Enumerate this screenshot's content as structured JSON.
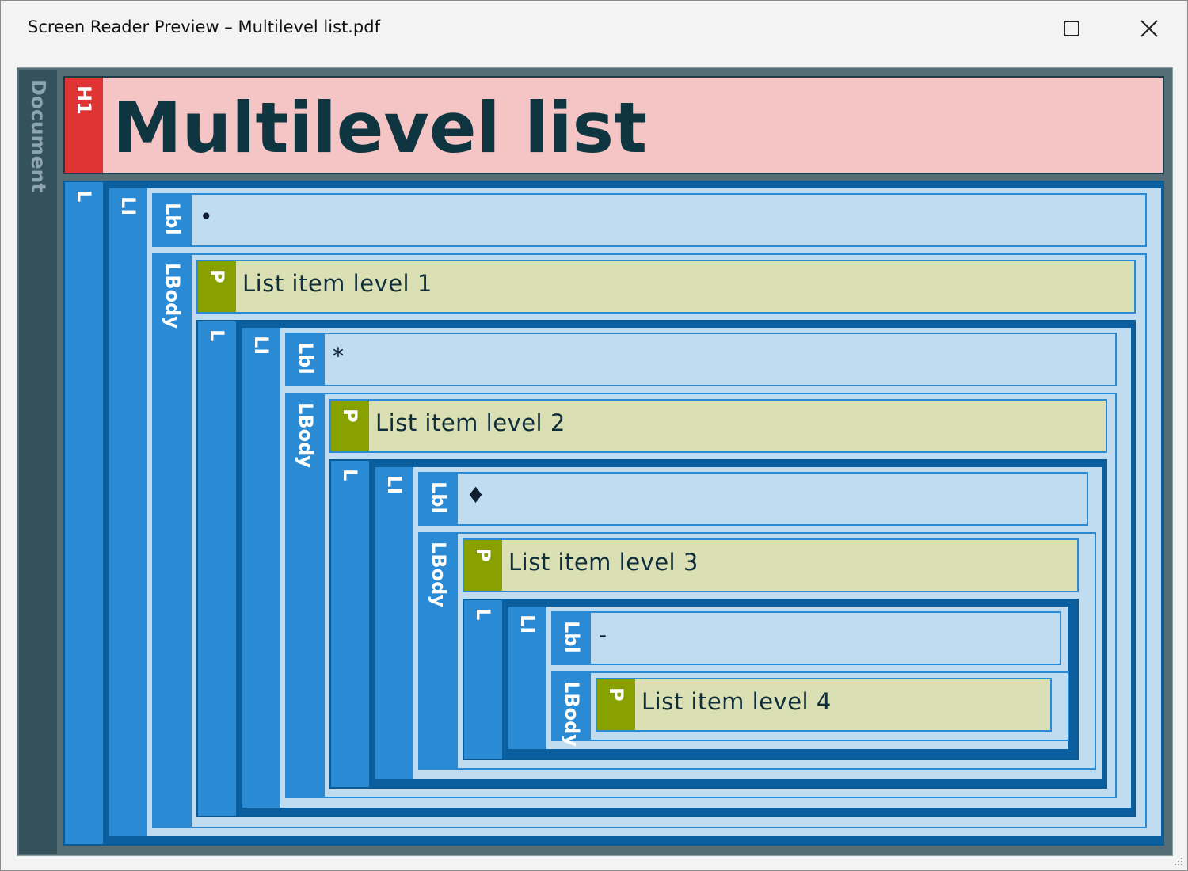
{
  "window": {
    "title": "Screen Reader Preview – Multilevel list.pdf",
    "maximize_icon": "maximize-icon",
    "close_icon": "close-icon"
  },
  "colors": {
    "document": "#35515c",
    "heading_tag": "#e03333",
    "heading_bg": "#f5c4c4",
    "list_dark": "#0b5f9e",
    "list_tag": "#2a8bd4",
    "list_light": "#bfdcf1",
    "para_tag": "#88a000",
    "para_bg": "#dbe0b4"
  },
  "document": {
    "tag": "Document",
    "heading": {
      "tag": "H1",
      "text": "Multilevel list"
    },
    "list": {
      "tags": {
        "list": "L",
        "item": "LI",
        "label": "Lbl",
        "body": "LBody",
        "paragraph": "P"
      },
      "levels": [
        {
          "label": "•",
          "text": "List item level 1"
        },
        {
          "label": "*",
          "text": "List item level 2"
        },
        {
          "label": "♦",
          "text": "List item level 3"
        },
        {
          "label": "-",
          "text": "List item level 4"
        }
      ]
    }
  }
}
